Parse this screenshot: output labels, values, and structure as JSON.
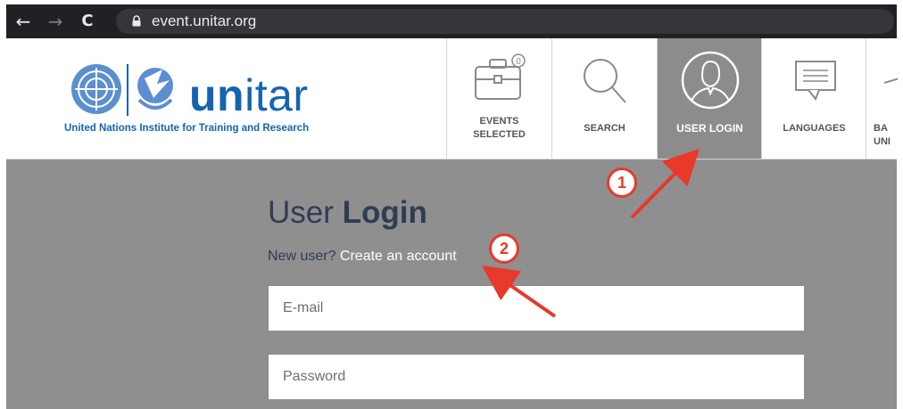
{
  "browser": {
    "url": "event.unitar.org",
    "back_glyph": "←",
    "forward_glyph": "→",
    "reload_glyph": "C"
  },
  "header": {
    "logo_word_bold": "un",
    "logo_word_thin": "itar",
    "logo_subtitle": "United Nations Institute for Training and Research",
    "tiles": [
      {
        "label_line1": "EVENTS",
        "label_line2": "SELECTED",
        "badge": "0"
      },
      {
        "label_line1": "SEARCH",
        "label_line2": ""
      },
      {
        "label_line1": "USER LOGIN",
        "label_line2": ""
      },
      {
        "label_line1": "LANGUAGES",
        "label_line2": ""
      },
      {
        "label_line1": "BA",
        "label_line2": "UNI"
      }
    ]
  },
  "login": {
    "title_normal": "User ",
    "title_bold": "Login",
    "new_user_text": "New user? ",
    "create_account_link": "Create an account",
    "email_placeholder": "E-mail",
    "password_placeholder": "Password"
  },
  "annotations": {
    "color": "#e8392b",
    "step1": "1",
    "step2": "2"
  },
  "colors": {
    "brand_blue": "#1464b4",
    "main_bg": "#8f8f8f",
    "active_tile_bg": "#8c8c8c",
    "title_text": "#2d3e54"
  }
}
